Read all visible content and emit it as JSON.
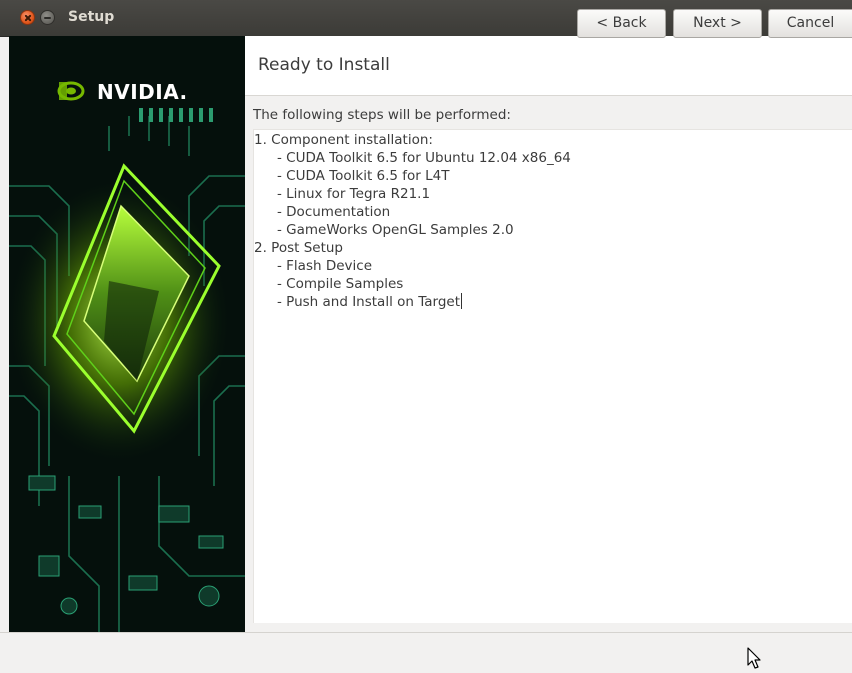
{
  "window": {
    "title": "Setup"
  },
  "banner": {
    "logo_text": "NVIDIA."
  },
  "header": {
    "title": "Ready to Install"
  },
  "main": {
    "intro": "The following steps will be performed:",
    "lines": [
      "1. Component installation:",
      "- CUDA Toolkit 6.5 for Ubuntu 12.04 x86_64",
      "- CUDA Toolkit 6.5 for L4T",
      "- Linux for Tegra R21.1",
      "- Documentation",
      "- GameWorks OpenGL Samples 2.0",
      "2. Post Setup",
      "- Flash Device",
      "- Compile Samples",
      "- Push and Install on Target"
    ]
  },
  "footer": {
    "back_label": "< Back",
    "next_label": "Next >",
    "cancel_label": "Cancel"
  },
  "colors": {
    "titlebar": "#3c3b37",
    "banner_bg": "#05100c",
    "nvidia_green": "#76b900",
    "window_bg": "#f2f1f0"
  }
}
